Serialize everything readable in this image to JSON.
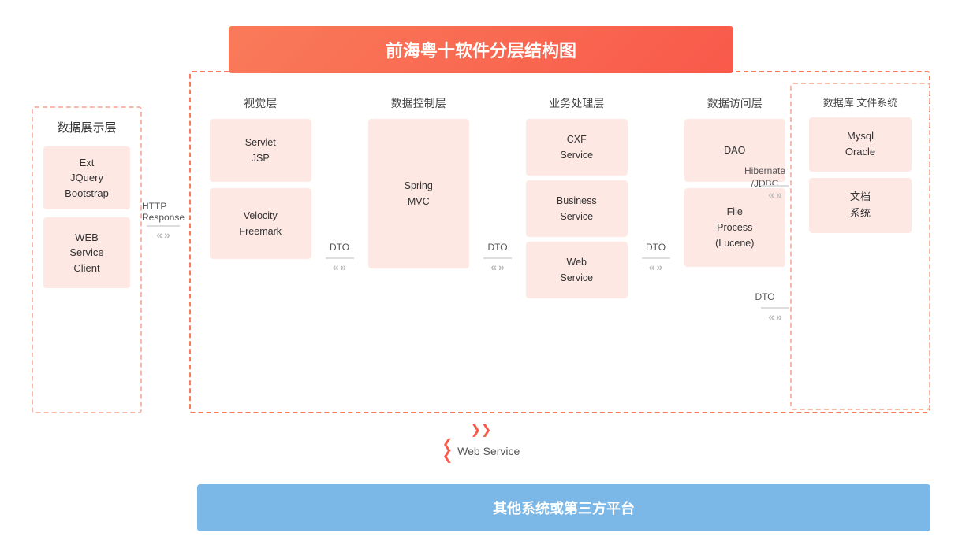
{
  "title": "前海粤十软件分层结构图",
  "left_panel": {
    "title": "数据展示层",
    "box1": "Ext\nJQuery\nBootstrap",
    "box2": "WEB\nService\nClient"
  },
  "http_label": "HTTP\nResponse",
  "layers": [
    {
      "id": "visual",
      "title": "视觉层",
      "boxes": [
        "Servlet\nJSP",
        "Velocity\nFreemark"
      ]
    },
    {
      "id": "control",
      "title": "数据控制层",
      "boxes": [
        "Spring\nMVC"
      ]
    },
    {
      "id": "biz",
      "title": "业务处理层",
      "boxes": [
        "CXF\nService",
        "Business\nService",
        "Web\nService"
      ]
    },
    {
      "id": "dao",
      "title": "数据访问层",
      "boxes": [
        "DAO",
        "File\nProcess\n(Lucene)"
      ]
    }
  ],
  "connectors": [
    "DTO",
    "DTO",
    "DTO"
  ],
  "right_panel": {
    "title1": "Hibernate\n/JDBC",
    "dto_label": "DTO",
    "title2": "数据库\n文件系统",
    "box1": "Mysql\nOracle",
    "box2": "文档\n系统"
  },
  "bottom_web_service": "Web Service",
  "bottom_bar": "其他系统或第三方平台"
}
